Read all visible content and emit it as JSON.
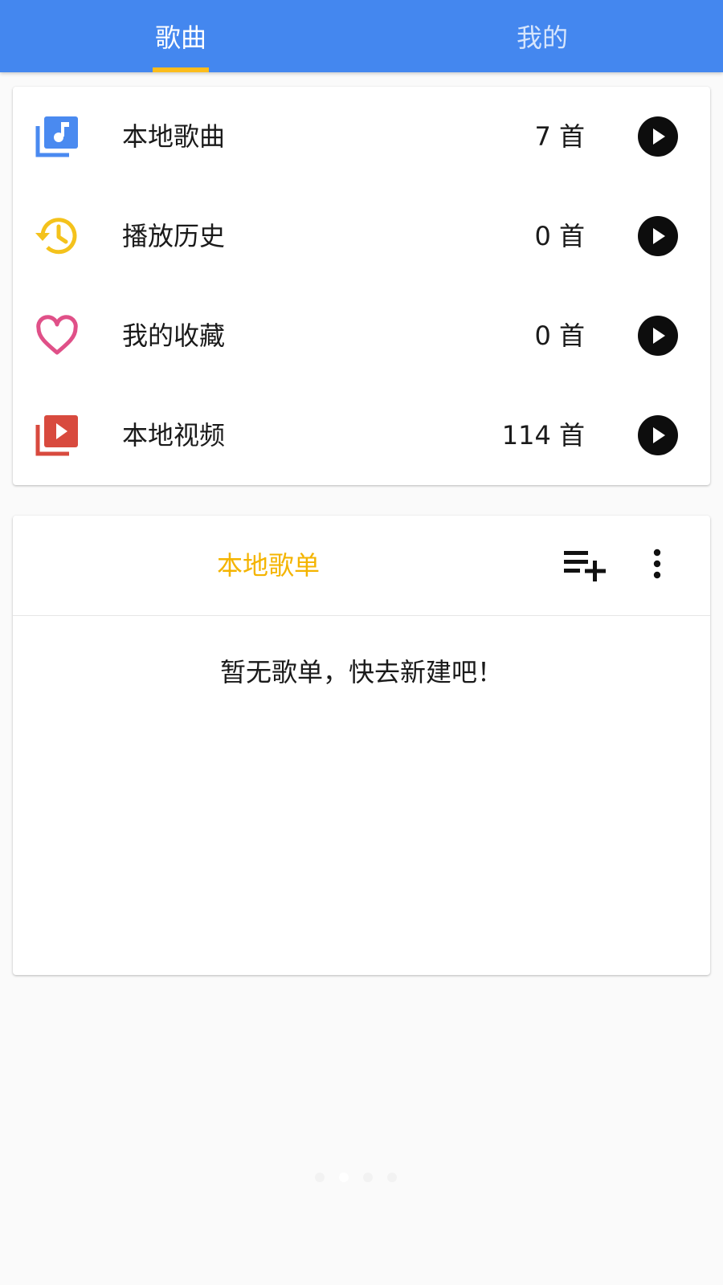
{
  "tabs": [
    {
      "label": "歌曲",
      "active": true
    },
    {
      "label": "我的",
      "active": false
    }
  ],
  "colors": {
    "header": "#4487ef",
    "tab_indicator": "#fbbc1c",
    "playlist_title": "#f4b400",
    "music_icon": "#4a8af0",
    "history_icon": "#f4c21c",
    "favorite_icon": "#e05088",
    "video_icon": "#d84a3e"
  },
  "library": [
    {
      "label": "本地歌曲",
      "count": "7 首",
      "icon": "music-library-icon"
    },
    {
      "label": "播放历史",
      "count": "0 首",
      "icon": "history-icon"
    },
    {
      "label": "我的收藏",
      "count": "0 首",
      "icon": "heart-icon"
    },
    {
      "label": "本地视频",
      "count": "114 首",
      "icon": "video-library-icon"
    }
  ],
  "playlist": {
    "title": "本地歌单",
    "add_icon": "playlist-add-icon",
    "more_icon": "more-vert-icon",
    "empty_message": "暂无歌单，快去新建吧！"
  },
  "page_indicator": {
    "count": 4,
    "active_index": 1
  }
}
